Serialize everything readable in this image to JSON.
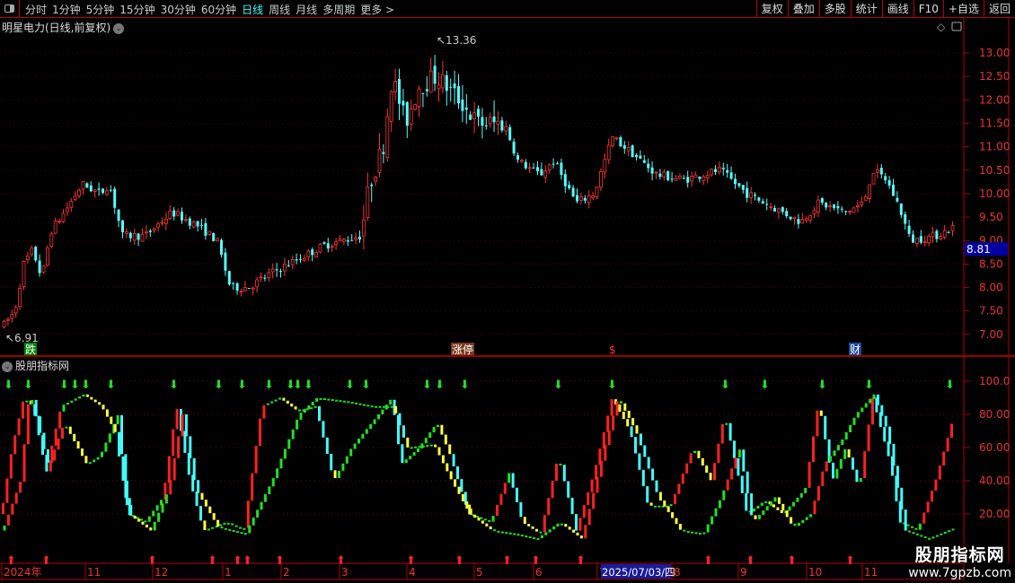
{
  "toolbar": {
    "periods": [
      "分时",
      "1分钟",
      "5分钟",
      "15分钟",
      "30分钟",
      "60分钟",
      "日线",
      "周线",
      "月线",
      "多周期",
      "更多 >"
    ],
    "active": "日线",
    "buttons": [
      "复权",
      "叠加",
      "多股",
      "统计",
      "画线",
      "F10",
      "+自选",
      "返回"
    ]
  },
  "chart": {
    "title": "明星电力(日线,前复权)",
    "high_label": "13.36",
    "low_label": "6.91",
    "current_price": "8.81",
    "price_ticks": [
      "13.00",
      "12.50",
      "12.00",
      "11.50",
      "11.00",
      "10.50",
      "10.00",
      "9.50",
      "9.00",
      "8.50",
      "8.00",
      "7.50",
      "7.00"
    ],
    "markers": [
      "跌",
      "涨停",
      "$",
      "财"
    ]
  },
  "indicator": {
    "title": "股朋指标网",
    "ticks": [
      "100.0",
      "80.00",
      "60.00",
      "40.00",
      "20.00"
    ]
  },
  "date_axis": {
    "labels": [
      "2024年",
      "11",
      "12",
      "1",
      "2",
      "3",
      "4",
      "5",
      "6",
      "7",
      "8",
      "9",
      "10",
      "11"
    ],
    "cursor_date": "2025/07/03/四"
  },
  "watermark": {
    "name": "股朋指标网",
    "url": "www.7gpzb.com"
  },
  "colors": {
    "up": "#ff3232",
    "down": "#54ffff",
    "grid": "#b00000",
    "accent": "#3ff"
  }
}
